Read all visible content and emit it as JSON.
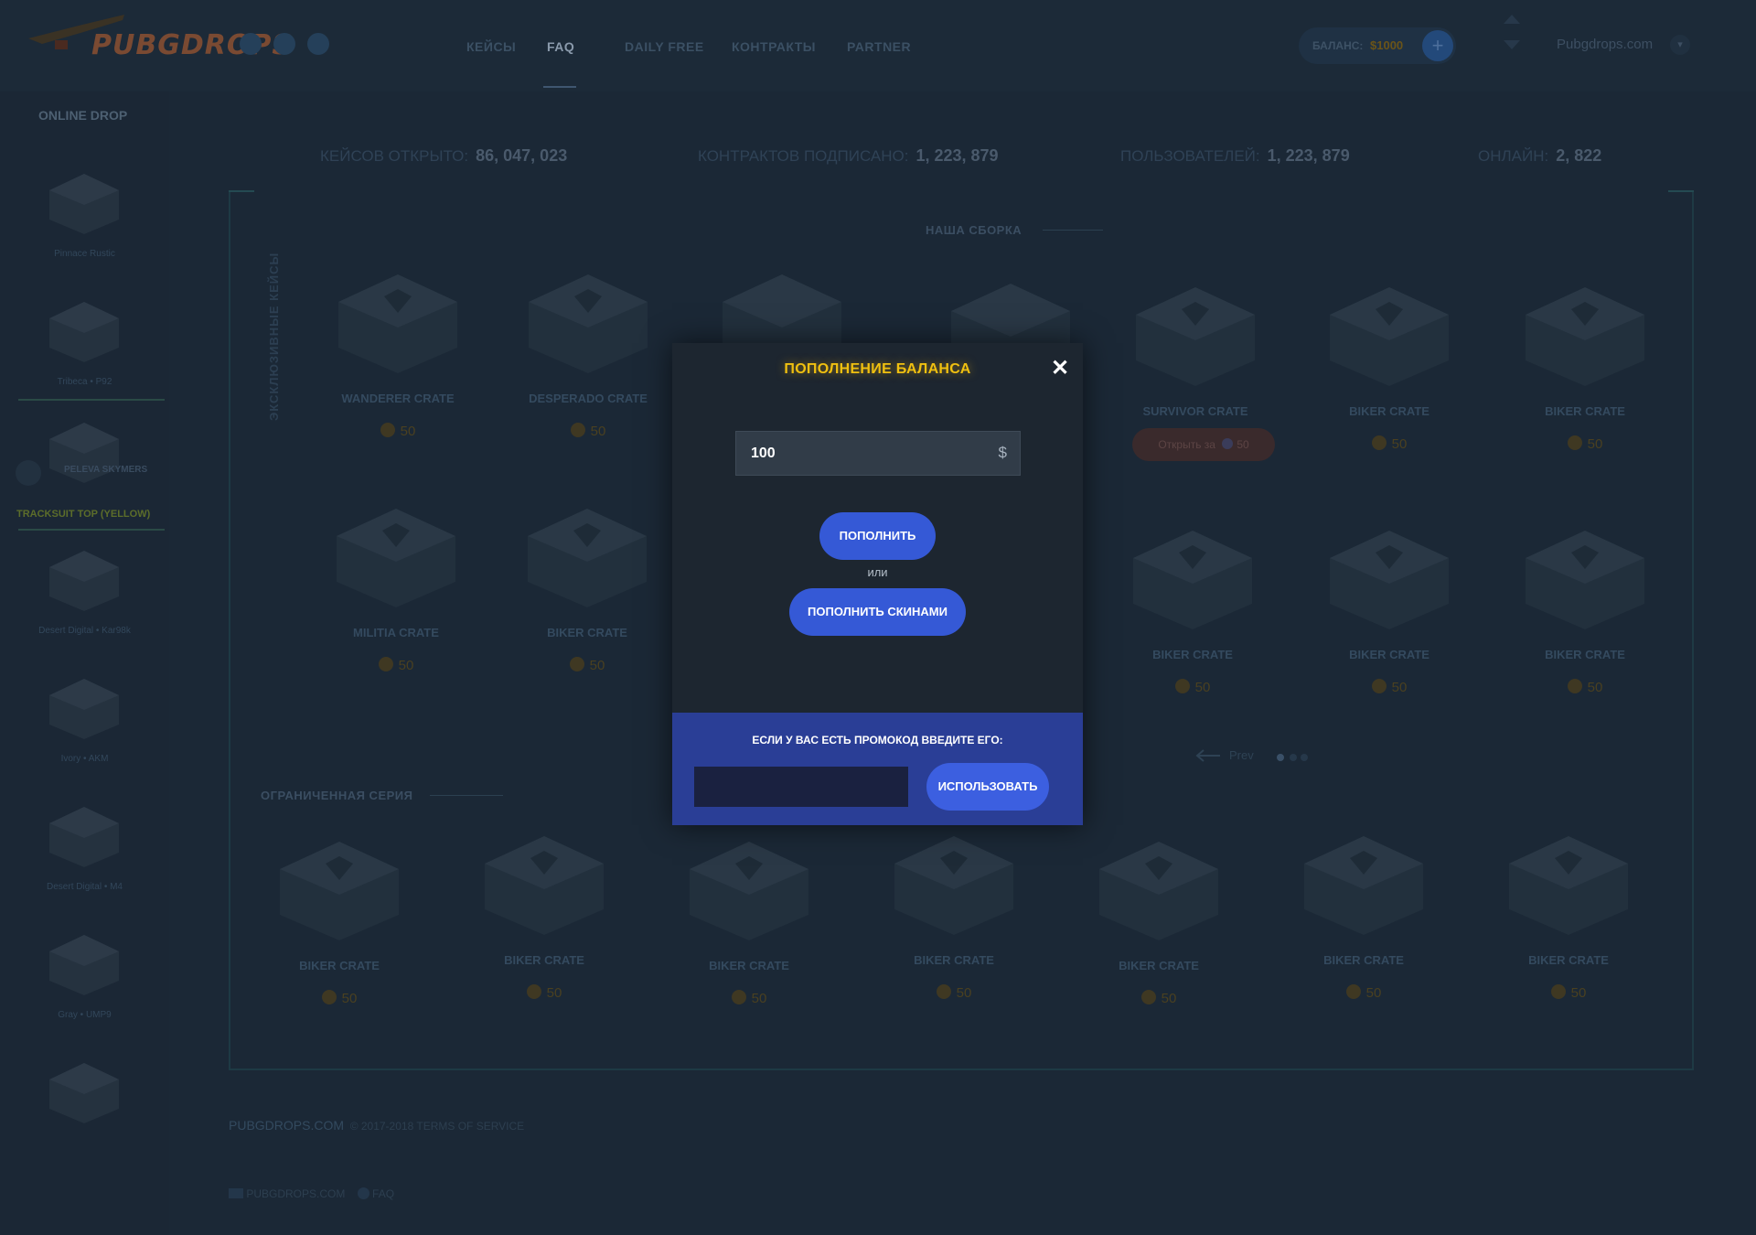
{
  "header": {
    "logo_text": "PUBGDROPS",
    "nav": [
      {
        "label": "КЕЙСЫ",
        "active": false
      },
      {
        "label": "FAQ",
        "active": true
      },
      {
        "label": "DAILY FREE",
        "active": false
      },
      {
        "label": "КОНТРАКТЫ",
        "active": false
      },
      {
        "label": "PARTNER",
        "active": false
      }
    ],
    "balance_label": "БАЛАНС:",
    "balance_value": "$1000",
    "balance_add": "+",
    "username": "Pubgdrops.com",
    "user_menu": "▾"
  },
  "sidebar": {
    "title": "ONLINE DROP",
    "items": [
      {
        "label": "Pinnace Rustic"
      },
      {
        "label": "Tribeca • P92"
      },
      {
        "label": ""
      },
      {
        "label": "Desert Digital • Kar98k"
      },
      {
        "label": "Ivory • AKM"
      },
      {
        "label": "Desert Digital • M4"
      },
      {
        "label": "Gray • UMP9"
      },
      {
        "label": ""
      }
    ],
    "player_name": "PELEVA SKYMERS",
    "highlight_label": "TRACKSUIT TOP (YELLOW)"
  },
  "stats": [
    {
      "label": "КЕЙСОВ ОТКРЫТО:",
      "value": "86, 047, 023"
    },
    {
      "label": "КОНТРАКТОВ ПОДПИСАНО:",
      "value": "1, 223, 879"
    },
    {
      "label": "ПОЛЬЗОВАТЕЛЕЙ:",
      "value": "1, 223, 879"
    },
    {
      "label": "ОНЛАЙН:",
      "value": "2, 822"
    }
  ],
  "sections": {
    "our_build": "НАША СБОРКА",
    "exclusive": "ЭКСКЛЮЗИВНЫЕ КЕЙСЫ",
    "limited": "ОГРАНИЧЕННАЯ СЕРИЯ"
  },
  "crates_row1": [
    {
      "name": "WANDERER CRATE",
      "price": "50"
    },
    {
      "name": "DESPERADO CRATE",
      "price": "50"
    },
    {
      "name": "SURVIVOR CRATE",
      "price": "50",
      "open_label": "Открыть за",
      "open_price": "50"
    },
    {
      "name": "BIKER CRATE",
      "price": "50"
    },
    {
      "name": "BIKER CRATE",
      "price": "50"
    }
  ],
  "crates_row2": [
    {
      "name": "MILITIA CRATE",
      "price": "50"
    },
    {
      "name": "BIKER CRATE",
      "price": "50"
    },
    {
      "name": "BIKER CRATE",
      "price": "50"
    },
    {
      "name": "BIKER CRATE",
      "price": "50"
    },
    {
      "name": "BIKER CRATE",
      "price": "50"
    }
  ],
  "crates_limited": [
    {
      "name": "BIKER CRATE",
      "price": "50"
    },
    {
      "name": "BIKER CRATE",
      "price": "50"
    },
    {
      "name": "BIKER CRATE",
      "price": "50"
    },
    {
      "name": "BIKER CRATE",
      "price": "50"
    },
    {
      "name": "BIKER CRATE",
      "price": "50"
    },
    {
      "name": "BIKER CRATE",
      "price": "50"
    },
    {
      "name": "BIKER CRATE",
      "price": "50"
    }
  ],
  "pager": {
    "prev": "Prev"
  },
  "footer": {
    "brand": "PUBGDROPS.COM",
    "copyright": "© 2017-2018",
    "terms": "TERMS OF SERVICE",
    "mail": "PUBGDROPS.COM",
    "faq": "FAQ"
  },
  "modal": {
    "title": "ПОПОЛНЕНИЕ БАЛАНСА",
    "close": "✕",
    "amount_value": "100",
    "currency": "$",
    "topup_button": "ПОПОЛНИТЬ",
    "or_text": "или",
    "skins_button": "ПОПОЛНИТЬ СКИНАМИ",
    "promo_prompt": "ЕСЛИ У ВАС ЕСТЬ ПРОМОКОД ВВЕДИТЕ ЕГО:",
    "promo_placeholder": "",
    "use_button": "ИСПОЛЬЗОВАТЬ"
  },
  "colors": {
    "modal_title": "#f0c010",
    "button_blue": "#3559d6",
    "promo_panel": "#2a3e96",
    "background": "#1b2836"
  }
}
